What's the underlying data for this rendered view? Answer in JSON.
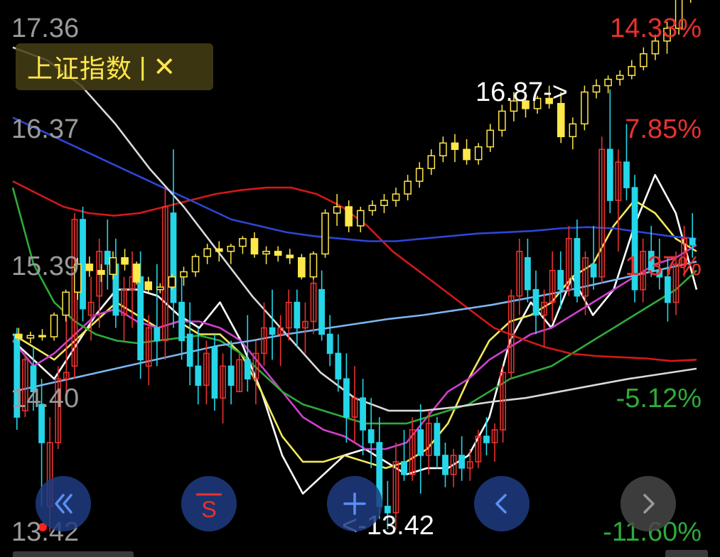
{
  "legend": {
    "index_name": "上证指数",
    "separator": "|",
    "close_glyph": "✕"
  },
  "y_labels": [
    "17.36",
    "16.37",
    "15.39",
    "14.40",
    "13.42"
  ],
  "pct_labels": [
    {
      "text": "14.33%",
      "color": "#e8322e"
    },
    {
      "text": "7.85%",
      "color": "#e8322e"
    },
    {
      "text": "1.37%",
      "color": "#e8322e"
    },
    {
      "text": "-5.12%",
      "color": "#2eab3a"
    },
    {
      "text": "-11.60%",
      "color": "#2eab3a"
    }
  ],
  "annotations": {
    "high": "16.87->",
    "low": "<-13.42"
  },
  "nav_buttons": [
    {
      "name": "fast-back",
      "icon": "double-chevron-left-icon",
      "glyph": "«"
    },
    {
      "name": "overlay",
      "icon": "overlay-s-icon",
      "glyph": "S"
    },
    {
      "name": "zoom-in",
      "icon": "plus-icon",
      "glyph": "+"
    },
    {
      "name": "prev",
      "icon": "chevron-left-icon",
      "glyph": "‹"
    },
    {
      "name": "next",
      "icon": "chevron-right-icon",
      "glyph": "›"
    }
  ],
  "colors": {
    "up": "#e8322e",
    "down": "#25d6e8",
    "index": "#ffe84a"
  },
  "chart_data": {
    "type": "candlestick",
    "ylim": [
      13.42,
      17.36
    ],
    "yticks": [
      17.36,
      16.37,
      15.39,
      14.4,
      13.42
    ],
    "stock_candles_ohlc": [
      [
        14.95,
        15.0,
        14.2,
        14.3
      ],
      [
        14.35,
        14.8,
        14.3,
        14.75
      ],
      [
        14.7,
        14.85,
        14.35,
        14.5
      ],
      [
        14.4,
        14.6,
        13.6,
        14.1
      ],
      [
        13.6,
        14.3,
        13.4,
        14.1
      ],
      [
        14.1,
        14.7,
        14.05,
        14.6
      ],
      [
        14.6,
        15.1,
        14.4,
        14.65
      ],
      [
        14.7,
        15.9,
        14.6,
        15.85
      ],
      [
        15.85,
        15.95,
        15.05,
        15.15
      ],
      [
        15.1,
        15.4,
        14.9,
        15.2
      ],
      [
        15.25,
        15.7,
        15.0,
        15.6
      ],
      [
        15.6,
        15.85,
        15.3,
        15.5
      ],
      [
        15.5,
        15.7,
        15.0,
        15.1
      ],
      [
        15.1,
        15.4,
        14.9,
        15.3
      ],
      [
        15.3,
        15.6,
        15.0,
        15.4
      ],
      [
        15.4,
        15.6,
        14.6,
        14.75
      ],
      [
        14.7,
        15.1,
        14.55,
        15.0
      ],
      [
        15.0,
        15.5,
        14.7,
        14.9
      ],
      [
        14.9,
        16.1,
        14.75,
        15.95
      ],
      [
        15.9,
        16.4,
        15.0,
        15.2
      ],
      [
        15.2,
        15.4,
        14.75,
        14.9
      ],
      [
        14.95,
        15.2,
        14.55,
        14.7
      ],
      [
        14.7,
        15.0,
        14.4,
        14.55
      ],
      [
        14.55,
        14.9,
        14.4,
        14.8
      ],
      [
        14.85,
        14.95,
        14.35,
        14.45
      ],
      [
        14.45,
        14.8,
        14.25,
        14.7
      ],
      [
        14.7,
        14.9,
        14.4,
        14.55
      ],
      [
        14.5,
        14.8,
        14.5,
        14.75
      ],
      [
        14.75,
        15.1,
        14.5,
        14.6
      ],
      [
        14.6,
        14.9,
        14.4,
        14.8
      ],
      [
        14.8,
        15.2,
        14.7,
        15.0
      ],
      [
        15.0,
        15.3,
        14.75,
        14.95
      ],
      [
        14.95,
        15.1,
        14.7,
        15.0
      ],
      [
        15.0,
        15.3,
        14.9,
        15.2
      ],
      [
        15.2,
        15.3,
        14.85,
        15.0
      ],
      [
        15.0,
        15.2,
        14.8,
        15.05
      ],
      [
        15.05,
        15.4,
        14.95,
        15.35
      ],
      [
        15.3,
        15.45,
        14.9,
        14.95
      ],
      [
        14.95,
        15.1,
        14.7,
        14.8
      ],
      [
        14.8,
        14.95,
        14.5,
        14.6
      ],
      [
        14.6,
        14.8,
        14.1,
        14.3
      ],
      [
        14.3,
        14.7,
        14.1,
        14.45
      ],
      [
        14.45,
        14.6,
        14.0,
        14.2
      ],
      [
        14.2,
        14.45,
        13.9,
        14.1
      ],
      [
        14.1,
        14.3,
        13.5,
        13.6
      ],
      [
        13.6,
        13.8,
        13.42,
        13.55
      ],
      [
        13.55,
        14.1,
        13.42,
        13.95
      ],
      [
        13.95,
        14.2,
        13.8,
        13.85
      ],
      [
        13.85,
        14.3,
        13.8,
        14.2
      ],
      [
        14.2,
        14.4,
        13.7,
        14.0
      ],
      [
        14.0,
        14.35,
        13.85,
        14.25
      ],
      [
        14.25,
        14.3,
        13.9,
        14.0
      ],
      [
        14.0,
        14.1,
        13.75,
        13.85
      ],
      [
        13.85,
        14.05,
        13.75,
        14.0
      ],
      [
        14.0,
        14.15,
        13.8,
        13.9
      ],
      [
        13.9,
        14.05,
        13.8,
        13.95
      ],
      [
        13.95,
        14.2,
        13.9,
        14.15
      ],
      [
        14.15,
        14.3,
        14.0,
        14.1
      ],
      [
        14.1,
        14.25,
        13.95,
        14.2
      ],
      [
        14.2,
        14.7,
        14.1,
        14.65
      ],
      [
        14.65,
        15.3,
        14.6,
        15.25
      ],
      [
        15.25,
        15.7,
        15.1,
        15.6
      ],
      [
        15.55,
        15.7,
        15.2,
        15.3
      ],
      [
        15.3,
        15.45,
        14.95,
        15.1
      ],
      [
        15.1,
        15.3,
        14.85,
        15.2
      ],
      [
        15.2,
        15.6,
        15.05,
        15.45
      ],
      [
        15.45,
        15.6,
        15.15,
        15.3
      ],
      [
        15.3,
        15.8,
        15.25,
        15.7
      ],
      [
        15.7,
        15.85,
        15.2,
        15.25
      ],
      [
        15.25,
        15.6,
        15.1,
        15.55
      ],
      [
        15.5,
        15.8,
        15.3,
        15.4
      ],
      [
        15.4,
        16.5,
        15.35,
        16.4
      ],
      [
        16.4,
        16.87,
        15.9,
        16.0
      ],
      [
        16.0,
        16.4,
        15.6,
        16.3
      ],
      [
        16.3,
        16.6,
        16.0,
        16.1
      ],
      [
        16.1,
        16.2,
        15.2,
        15.3
      ],
      [
        15.3,
        15.7,
        15.2,
        15.6
      ],
      [
        15.6,
        15.8,
        15.4,
        15.45
      ],
      [
        15.45,
        15.7,
        15.3,
        15.4
      ],
      [
        15.4,
        15.55,
        15.05,
        15.2
      ],
      [
        15.2,
        15.6,
        15.1,
        15.5
      ],
      [
        15.5,
        15.8,
        15.4,
        15.7
      ],
      [
        15.7,
        15.9,
        15.55,
        15.65
      ]
    ],
    "index_candles_ohlc": [
      [
        14.95,
        15.0,
        14.9,
        14.92
      ],
      [
        14.92,
        14.97,
        14.88,
        14.94
      ],
      [
        14.94,
        14.99,
        14.9,
        14.93
      ],
      [
        14.93,
        15.12,
        14.9,
        15.1
      ],
      [
        15.1,
        15.3,
        15.05,
        15.28
      ],
      [
        15.28,
        15.55,
        15.22,
        15.5
      ],
      [
        15.5,
        15.56,
        15.4,
        15.45
      ],
      [
        15.45,
        15.5,
        15.36,
        15.42
      ],
      [
        15.42,
        15.6,
        15.38,
        15.55
      ],
      [
        15.55,
        15.62,
        15.45,
        15.5
      ],
      [
        15.5,
        15.52,
        15.34,
        15.36
      ],
      [
        15.36,
        15.4,
        15.28,
        15.3
      ],
      [
        15.3,
        15.35,
        15.27,
        15.32
      ],
      [
        15.32,
        15.42,
        15.3,
        15.4
      ],
      [
        15.4,
        15.48,
        15.33,
        15.44
      ],
      [
        15.44,
        15.58,
        15.4,
        15.56
      ],
      [
        15.56,
        15.66,
        15.5,
        15.62
      ],
      [
        15.62,
        15.68,
        15.52,
        15.6
      ],
      [
        15.6,
        15.66,
        15.5,
        15.64
      ],
      [
        15.64,
        15.72,
        15.58,
        15.7
      ],
      [
        15.7,
        15.75,
        15.55,
        15.58
      ],
      [
        15.58,
        15.64,
        15.5,
        15.6
      ],
      [
        15.6,
        15.64,
        15.52,
        15.57
      ],
      [
        15.57,
        15.62,
        15.5,
        15.55
      ],
      [
        15.55,
        15.58,
        15.38,
        15.4
      ],
      [
        15.4,
        15.6,
        15.38,
        15.58
      ],
      [
        15.58,
        15.93,
        15.55,
        15.9
      ],
      [
        15.9,
        16.05,
        15.8,
        15.95
      ],
      [
        15.95,
        16.0,
        15.75,
        15.8
      ],
      [
        15.8,
        15.95,
        15.75,
        15.92
      ],
      [
        15.92,
        16.0,
        15.88,
        15.96
      ],
      [
        15.96,
        16.05,
        15.9,
        16.0
      ],
      [
        16.0,
        16.1,
        15.95,
        16.05
      ],
      [
        16.05,
        16.2,
        16.0,
        16.15
      ],
      [
        16.15,
        16.3,
        16.1,
        16.25
      ],
      [
        16.25,
        16.4,
        16.2,
        16.35
      ],
      [
        16.35,
        16.5,
        16.3,
        16.45
      ],
      [
        16.45,
        16.52,
        16.3,
        16.4
      ],
      [
        16.4,
        16.48,
        16.28,
        16.32
      ],
      [
        16.32,
        16.45,
        16.28,
        16.42
      ],
      [
        16.42,
        16.6,
        16.38,
        16.55
      ],
      [
        16.55,
        16.75,
        16.5,
        16.7
      ],
      [
        16.7,
        16.85,
        16.62,
        16.78
      ],
      [
        16.78,
        16.85,
        16.65,
        16.72
      ],
      [
        16.72,
        16.82,
        16.68,
        16.8
      ],
      [
        16.8,
        16.9,
        16.72,
        16.76
      ],
      [
        16.76,
        16.85,
        16.45,
        16.5
      ],
      [
        16.5,
        16.65,
        16.4,
        16.6
      ],
      [
        16.6,
        16.9,
        16.55,
        16.85
      ],
      [
        16.85,
        16.95,
        16.8,
        16.9
      ],
      [
        16.9,
        16.98,
        16.84,
        16.95
      ],
      [
        16.95,
        17.02,
        16.9,
        16.98
      ],
      [
        16.98,
        17.1,
        16.95,
        17.05
      ],
      [
        17.05,
        17.2,
        17.02,
        17.15
      ],
      [
        17.15,
        17.3,
        17.1,
        17.25
      ],
      [
        17.25,
        17.4,
        17.15,
        17.35
      ],
      [
        17.35,
        17.6,
        17.3,
        17.58
      ],
      [
        17.58,
        17.9,
        17.55,
        17.88
      ]
    ],
    "ma_lines": [
      {
        "color": "#ffffff",
        "values": [
          14.9,
          14.75,
          14.6,
          14.85,
          15.1,
          15.3,
          15.3,
          15.25,
          15.1,
          15.0,
          15.2,
          14.9,
          14.5,
          14.0,
          13.7,
          13.85,
          14.0,
          14.05,
          13.95,
          13.85,
          13.9,
          13.9,
          14.0,
          14.3,
          14.9,
          15.2,
          15.0,
          15.4,
          15.1,
          15.3,
          15.8,
          16.2,
          15.9,
          15.3
        ]
      },
      {
        "color": "#f2e85a",
        "values": [
          14.95,
          14.85,
          14.75,
          14.9,
          15.05,
          15.2,
          15.1,
          15.0,
          15.05,
          14.95,
          14.95,
          14.8,
          14.5,
          14.15,
          13.95,
          13.95,
          14.0,
          13.95,
          13.9,
          13.95,
          14.05,
          14.25,
          14.6,
          14.9,
          15.05,
          15.1,
          15.2,
          15.4,
          15.5,
          15.8,
          16.0,
          15.9,
          15.7,
          15.6
        ]
      },
      {
        "color": "#d040d0",
        "values": [
          14.9,
          14.7,
          14.8,
          14.95,
          15.1,
          15.15,
          15.05,
          15.0,
          15.05,
          15.05,
          15.0,
          14.9,
          14.7,
          14.5,
          14.3,
          14.2,
          14.15,
          14.05,
          14.05,
          14.1,
          14.3,
          14.5,
          14.6,
          14.75,
          14.85,
          14.95,
          15.0,
          15.1,
          15.2,
          15.3,
          15.4,
          15.5,
          15.55,
          15.65
        ]
      },
      {
        "color": "#2eab3a",
        "values": [
          16.1,
          15.5,
          15.2,
          15.05,
          14.95,
          14.9,
          14.88,
          14.9,
          14.92,
          14.94,
          14.9,
          14.8,
          14.65,
          14.5,
          14.4,
          14.35,
          14.3,
          14.25,
          14.25,
          14.25,
          14.3,
          14.35,
          14.4,
          14.5,
          14.6,
          14.65,
          14.7,
          14.8,
          14.9,
          15.0,
          15.1,
          15.2,
          15.3,
          15.45
        ]
      },
      {
        "color": "#d51818",
        "values": [
          16.15,
          16.05,
          15.95,
          15.9,
          15.88,
          15.9,
          15.95,
          16.0,
          16.05,
          16.08,
          16.1,
          16.1,
          16.05,
          15.95,
          15.8,
          15.6,
          15.45,
          15.3,
          15.15,
          15.0,
          14.92,
          14.85,
          14.8,
          14.78,
          14.77,
          14.76,
          14.74,
          14.75
        ]
      },
      {
        "color": "#2d46d6",
        "values": [
          16.65,
          16.55,
          16.45,
          16.35,
          16.25,
          16.15,
          16.05,
          15.95,
          15.85,
          15.8,
          15.75,
          15.72,
          15.7,
          15.68,
          15.68,
          15.7,
          15.72,
          15.74,
          15.75,
          15.76,
          15.78,
          15.79,
          15.78,
          15.75,
          15.72,
          15.7
        ]
      },
      {
        "color": "#d9d9d9",
        "values": [
          17.2,
          17.1,
          16.9,
          16.6,
          16.25,
          15.95,
          15.6,
          15.25,
          14.95,
          14.65,
          14.45,
          14.35,
          14.35,
          14.38,
          14.42,
          14.45,
          14.5,
          14.55,
          14.6,
          14.64,
          14.68
        ]
      },
      {
        "color": "#7db6f0",
        "values": [
          14.5,
          14.56,
          14.62,
          14.68,
          14.74,
          14.8,
          14.86,
          14.9,
          14.95,
          14.99,
          15.03,
          15.07,
          15.1,
          15.14,
          15.18,
          15.23,
          15.28,
          15.34,
          15.4,
          15.46,
          15.52
        ]
      }
    ],
    "annotations": {
      "high": 16.87,
      "low": 13.42
    }
  }
}
